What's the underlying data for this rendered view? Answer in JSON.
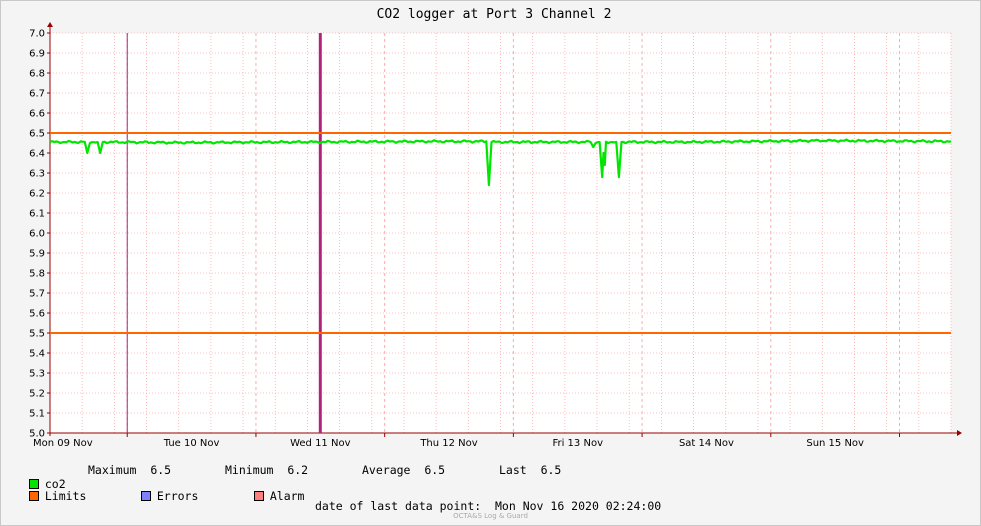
{
  "colors": {
    "background": "#f4f4f4",
    "plot_background": "#ffffff",
    "grid": "#ffaaaa",
    "axis": "#990000",
    "co2": "#00e600",
    "limits": "#ff6600",
    "errors": "#7f7fff",
    "alarm": "#ff7f7f",
    "marker": "#b3227a"
  },
  "legend": {
    "co2_label": "co2",
    "maximum_label": "Maximum",
    "maximum_value": "6.5",
    "minimum_label": "Minimum",
    "minimum_value": "6.2",
    "average_label": "Average",
    "average_value": "6.5",
    "last_label": "Last",
    "last_value": "6.5",
    "limits_label": "Limits",
    "errors_label": "Errors",
    "alarm_label": "Alarm"
  },
  "footer": {
    "date_text": "date of last data point:  Mon Nov 16 2020 02:24:00",
    "credit": "OCTA&S Log & Guard"
  },
  "chart_data": {
    "type": "line",
    "title": "CO2 logger at Port 3 Channel 2",
    "xlabel": "",
    "ylabel": "",
    "ylim": [
      5.0,
      7.0
    ],
    "yticks": [
      "5.0",
      "5.1",
      "5.2",
      "5.3",
      "5.4",
      "5.5",
      "5.6",
      "5.7",
      "5.8",
      "5.9",
      "6.0",
      "6.1",
      "6.2",
      "6.3",
      "6.4",
      "6.5",
      "6.6",
      "6.7",
      "6.8",
      "6.9",
      "7.0"
    ],
    "xlim": [
      0,
      7
    ],
    "x_unit": "days",
    "x_categories": [
      "Mon 09 Nov",
      "Tue 10 Nov",
      "Wed 11 Nov",
      "Thu 12 Nov",
      "Fri 13 Nov",
      "Sat 14 Nov",
      "Sun 15 Nov"
    ],
    "grid": true,
    "limits": [
      6.5,
      5.5
    ],
    "markers": [
      {
        "name": "thin",
        "x": 0.6
      },
      {
        "name": "thick",
        "x": 2.1
      }
    ],
    "series": [
      {
        "name": "co2",
        "baseline": 6.455,
        "points": [
          [
            0.0,
            6.455
          ],
          [
            0.27,
            6.455
          ],
          [
            0.29,
            6.4
          ],
          [
            0.31,
            6.455
          ],
          [
            0.37,
            6.455
          ],
          [
            0.39,
            6.4
          ],
          [
            0.41,
            6.455
          ],
          [
            1.0,
            6.452
          ],
          [
            2.0,
            6.455
          ],
          [
            3.0,
            6.458
          ],
          [
            3.39,
            6.458
          ],
          [
            3.41,
            6.24
          ],
          [
            3.43,
            6.455
          ],
          [
            4.2,
            6.455
          ],
          [
            4.22,
            6.43
          ],
          [
            4.24,
            6.455
          ],
          [
            4.27,
            6.455
          ],
          [
            4.29,
            6.28
          ],
          [
            4.3,
            6.4
          ],
          [
            4.31,
            6.34
          ],
          [
            4.32,
            6.455
          ],
          [
            4.4,
            6.455
          ],
          [
            4.42,
            6.28
          ],
          [
            4.44,
            6.455
          ],
          [
            5.0,
            6.455
          ],
          [
            6.0,
            6.462
          ],
          [
            7.0,
            6.458
          ]
        ]
      }
    ]
  }
}
